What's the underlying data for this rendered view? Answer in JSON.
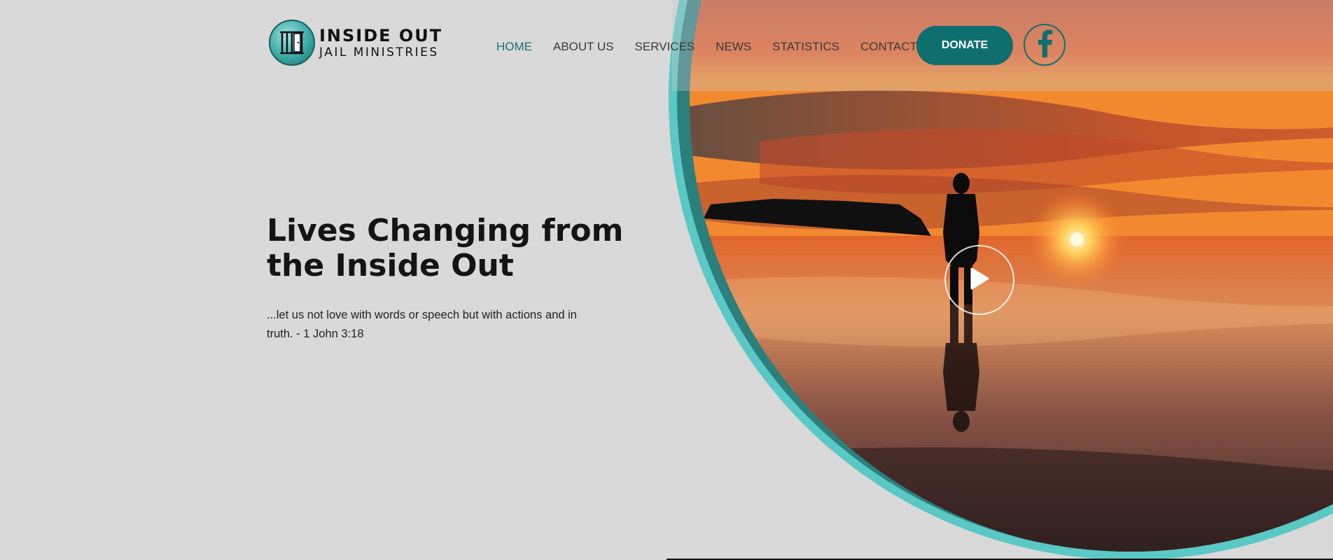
{
  "logo": {
    "line1": "INSIDE OUT",
    "line2": "JAIL MINISTRIES",
    "icon": "jail-door-icon"
  },
  "nav": {
    "items": [
      {
        "label": "HOME",
        "active": true
      },
      {
        "label": "ABOUT US",
        "active": false
      },
      {
        "label": "SERVICES",
        "active": false
      },
      {
        "label": "NEWS",
        "active": false
      },
      {
        "label": "STATISTICS",
        "active": false
      },
      {
        "label": "CONTACT US",
        "active": false
      }
    ]
  },
  "header": {
    "donate_label": "DONATE",
    "social_icon": "facebook-icon"
  },
  "hero": {
    "title": "Lives Changing from the Inside Out",
    "quote": "...let us not love with words or speech but with actions and in truth. - 1 John 3:18",
    "play_icon": "play-icon"
  },
  "colors": {
    "accent": "#0e6f6e",
    "ring_outer": "#5ac8c4",
    "ring_inner": "#2b7f7d",
    "background": "#d9d9d9"
  }
}
